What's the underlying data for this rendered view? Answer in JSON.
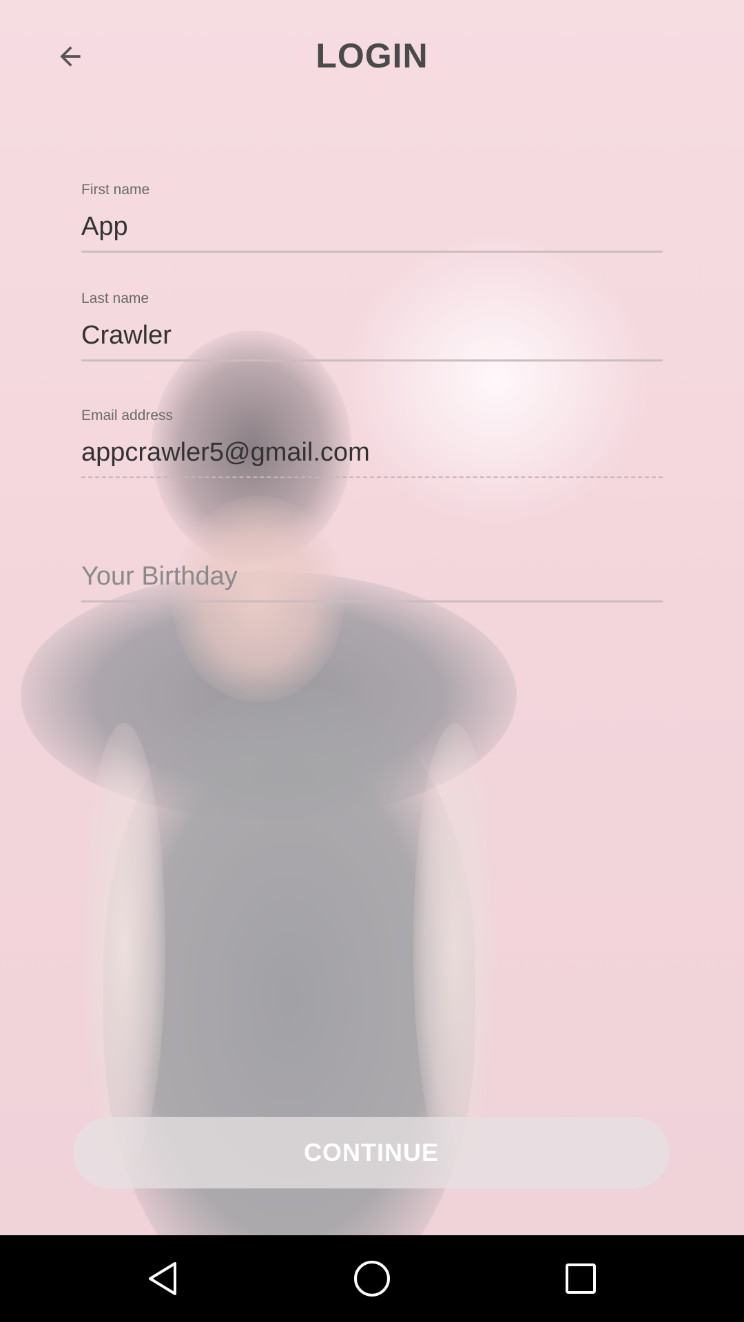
{
  "header": {
    "title": "LOGIN",
    "back_icon": "arrow-left-icon"
  },
  "form": {
    "first_name": {
      "label": "First name",
      "value": "App"
    },
    "last_name": {
      "label": "Last name",
      "value": "Crawler"
    },
    "email": {
      "label": "Email address",
      "value": "appcrawler5@gmail.com"
    },
    "birthday": {
      "placeholder": "Your Birthday",
      "value": ""
    }
  },
  "actions": {
    "continue_label": "CONTINUE"
  },
  "nav_bar": {
    "icons": [
      "nav-back-icon",
      "nav-home-icon",
      "nav-recents-icon"
    ]
  },
  "colors": {
    "background": "#f3d9de",
    "title_text": "#4a4a4a",
    "field_text": "#333333",
    "nav_bar": "#000000"
  }
}
